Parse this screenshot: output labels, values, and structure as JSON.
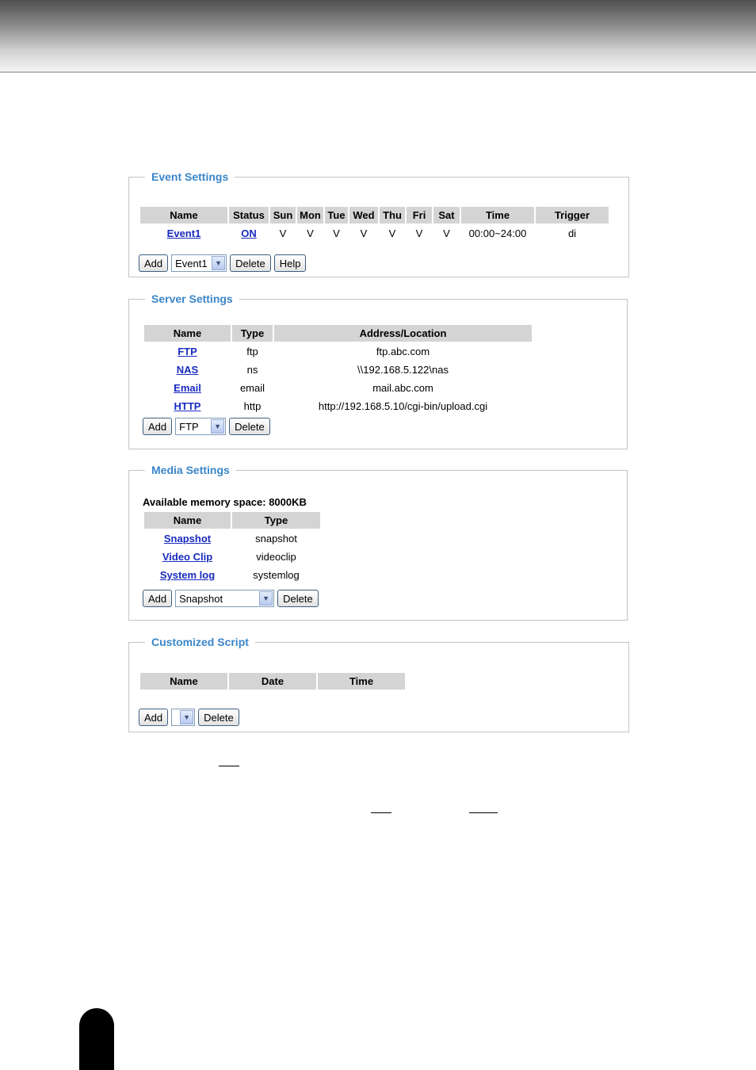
{
  "event_settings": {
    "legend": "Event Settings",
    "columns": [
      "Name",
      "Status",
      "Sun",
      "Mon",
      "Tue",
      "Wed",
      "Thu",
      "Fri",
      "Sat",
      "Time",
      "Trigger"
    ],
    "row": {
      "name": "Event1",
      "status": "ON",
      "days": [
        "V",
        "V",
        "V",
        "V",
        "V",
        "V",
        "V"
      ],
      "time": "00:00~24:00",
      "trigger": "di"
    },
    "add_label": "Add",
    "select_value": "Event1",
    "delete_label": "Delete",
    "help_label": "Help"
  },
  "server_settings": {
    "legend": "Server Settings",
    "columns": [
      "Name",
      "Type",
      "Address/Location"
    ],
    "rows": [
      {
        "name": "FTP",
        "type": "ftp",
        "address": "ftp.abc.com"
      },
      {
        "name": "NAS",
        "type": "ns",
        "address": "\\\\192.168.5.122\\nas"
      },
      {
        "name": "Email",
        "type": "email",
        "address": "mail.abc.com"
      },
      {
        "name": "HTTP",
        "type": "http",
        "address": "http://192.168.5.10/cgi-bin/upload.cgi"
      }
    ],
    "add_label": "Add",
    "select_value": "FTP",
    "delete_label": "Delete"
  },
  "media_settings": {
    "legend": "Media Settings",
    "memory_text": "Available memory space: 8000KB",
    "columns": [
      "Name",
      "Type"
    ],
    "rows": [
      {
        "name": "Snapshot",
        "type": "snapshot"
      },
      {
        "name": "Video Clip",
        "type": "videoclip"
      },
      {
        "name": "System log",
        "type": "systemlog"
      }
    ],
    "add_label": "Add",
    "select_value": "Snapshot",
    "delete_label": "Delete"
  },
  "customized_script": {
    "legend": "Customized Script",
    "columns": [
      "Name",
      "Date",
      "Time"
    ],
    "add_label": "Add",
    "select_value": "",
    "delete_label": "Delete"
  },
  "icons": {
    "dropdown": "chevron-down-icon"
  }
}
